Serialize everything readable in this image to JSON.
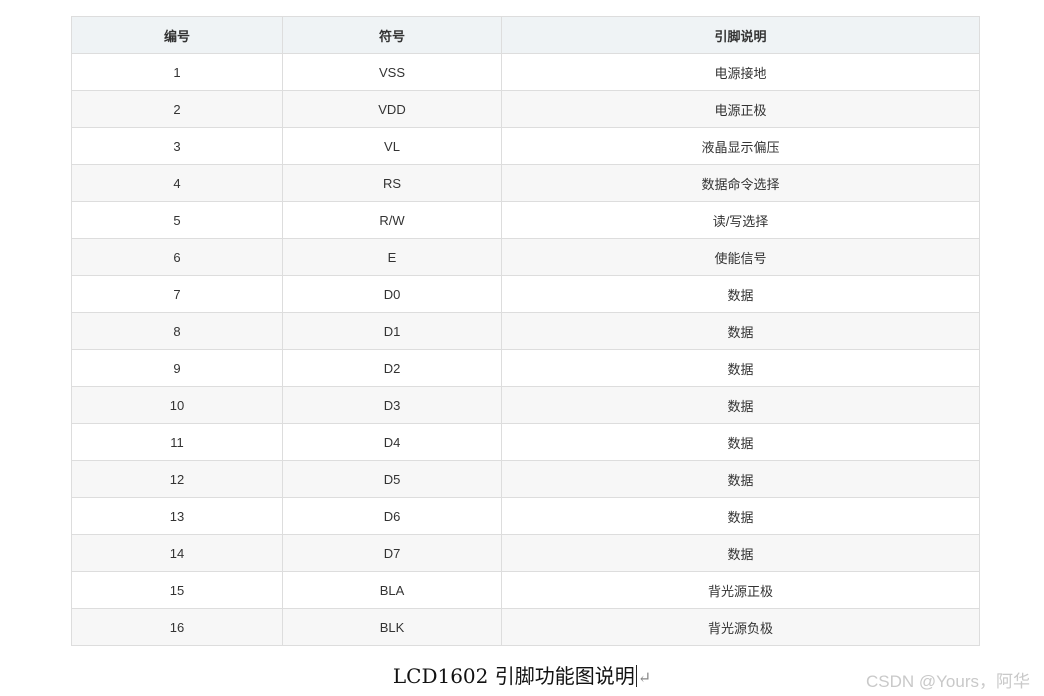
{
  "table": {
    "headers": [
      "编号",
      "符号",
      "引脚说明"
    ],
    "rows": [
      [
        "1",
        "VSS",
        "电源接地"
      ],
      [
        "2",
        "VDD",
        "电源正极"
      ],
      [
        "3",
        "VL",
        "液晶显示偏压"
      ],
      [
        "4",
        "RS",
        "数据命令选择"
      ],
      [
        "5",
        "R/W",
        "读/写选择"
      ],
      [
        "6",
        "E",
        "使能信号"
      ],
      [
        "7",
        "D0",
        "数据"
      ],
      [
        "8",
        "D1",
        "数据"
      ],
      [
        "9",
        "D2",
        "数据"
      ],
      [
        "10",
        "D3",
        "数据"
      ],
      [
        "11",
        "D4",
        "数据"
      ],
      [
        "12",
        "D5",
        "数据"
      ],
      [
        "13",
        "D6",
        "数据"
      ],
      [
        "14",
        "D7",
        "数据"
      ],
      [
        "15",
        "BLA",
        "背光源正极"
      ],
      [
        "16",
        "BLK",
        "背光源负极"
      ]
    ]
  },
  "caption": "LCD1602 引脚功能图说明",
  "caption_mark": "↵",
  "watermark": "CSDN @Yours，阿华"
}
